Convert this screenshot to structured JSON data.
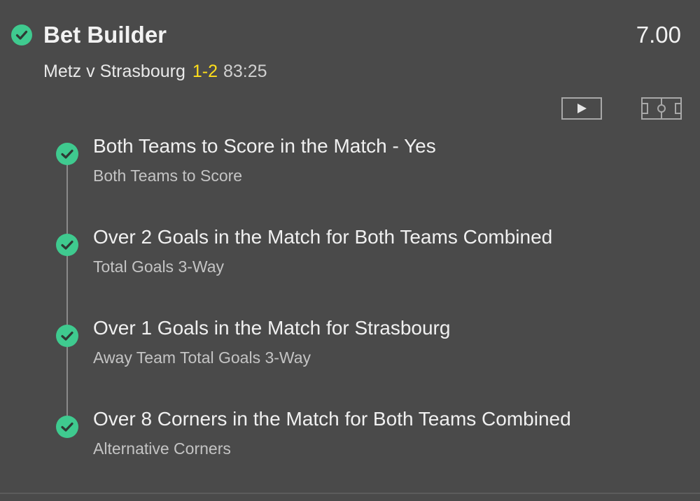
{
  "bet": {
    "title": "Bet Builder",
    "odds": "7.00",
    "status_icon": "check-circle-icon"
  },
  "match": {
    "teams": "Metz v Strasbourg",
    "score": "1-2",
    "clock": "83:25"
  },
  "media": {
    "stream_icon": "video-play-icon",
    "pitch_icon": "pitch-icon"
  },
  "legs": [
    {
      "selection": "Both Teams to Score in the Match - Yes",
      "market": "Both Teams to Score",
      "status_icon": "check-circle-icon"
    },
    {
      "selection": "Over 2 Goals in the Match for Both Teams Combined",
      "market": "Total Goals 3-Way",
      "status_icon": "check-circle-icon"
    },
    {
      "selection": "Over 1 Goals in the Match for Strasbourg",
      "market": "Away Team Total Goals 3-Way",
      "status_icon": "check-circle-icon"
    },
    {
      "selection": "Over 8 Corners in the Match for Both Teams Combined",
      "market": "Alternative Corners",
      "status_icon": "check-circle-icon"
    }
  ],
  "colors": {
    "background": "#4a4a4a",
    "check_green": "#3fca8f",
    "score_yellow": "#ffdf1b"
  }
}
